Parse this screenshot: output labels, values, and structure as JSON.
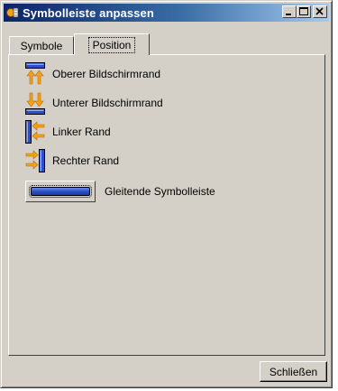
{
  "window": {
    "title": "Symbolleiste anpassen"
  },
  "tabs": [
    {
      "label": "Symbole",
      "active": false
    },
    {
      "label": "Position",
      "active": true
    }
  ],
  "positions": [
    {
      "label": "Oberer Bildschirmrand",
      "icon": "dock-top-icon"
    },
    {
      "label": "Unterer Bildschirmrand",
      "icon": "dock-bottom-icon"
    },
    {
      "label": "Linker Rand",
      "icon": "dock-left-icon"
    },
    {
      "label": "Rechter Rand",
      "icon": "dock-right-icon"
    }
  ],
  "floating": {
    "label": "Gleitende Symbolleiste",
    "icon": "floating-toolbar-icon"
  },
  "footer": {
    "close_label": "Schließen"
  },
  "colors": {
    "titlebar_start": "#0a246a",
    "titlebar_end": "#a6caf0",
    "dialog_bg": "#d4d0c8",
    "icon_blue": "#2a4fc9",
    "icon_orange": "#f5a01a"
  }
}
